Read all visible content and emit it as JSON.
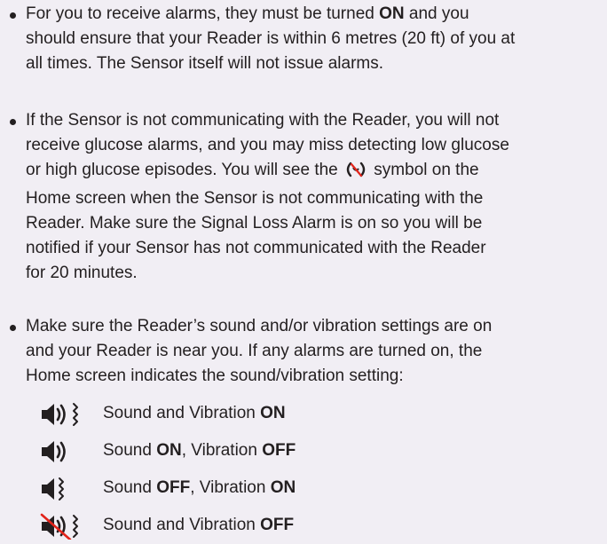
{
  "bullets": [
    {
      "lines": [
        [
          "For you to receive alarms, they must be turned ",
          {
            "b": "ON"
          },
          " and you"
        ],
        [
          "should ensure that your Reader is within 6 metres (20 ft) of you at"
        ],
        [
          "all times. The Sensor itself will not issue alarms."
        ]
      ]
    },
    {
      "lines": [
        [
          "If the Sensor is not communicating with the Reader, you will not"
        ],
        [
          "receive glucose alarms, and you may miss detecting low glucose"
        ],
        [
          "or high glucose episodes. You will see the ",
          {
            "icon": "signal-loss-icon"
          },
          " symbol on the"
        ],
        [
          "Home screen when the Sensor is not communicating with the"
        ],
        [
          "Reader. Make sure the Signal Loss Alarm is on so you will be"
        ],
        [
          "notified if your Sensor has not communicated with the Reader"
        ],
        [
          "for 20 minutes."
        ]
      ]
    },
    {
      "lines": [
        [
          "Make sure the Reader’s sound and/or vibration settings are on"
        ],
        [
          "and your Reader is near you. If any alarms are turned on, the"
        ],
        [
          "Home screen indicates the sound/vibration setting:"
        ]
      ]
    }
  ],
  "settings": [
    {
      "icon": "sound-on-vibration-on-icon",
      "parts": [
        "Sound and Vibration ",
        {
          "b": "ON"
        }
      ]
    },
    {
      "icon": "sound-on-vibration-off-icon",
      "parts": [
        "Sound ",
        {
          "b": "ON"
        },
        ", Vibration ",
        {
          "b": "OFF"
        }
      ]
    },
    {
      "icon": "sound-off-vibration-on-icon",
      "parts": [
        "Sound ",
        {
          "b": "OFF"
        },
        ", Vibration ",
        {
          "b": "ON"
        }
      ]
    },
    {
      "icon": "sound-off-vibration-off-icon",
      "parts": [
        "Sound and Vibration ",
        {
          "b": "OFF"
        }
      ]
    }
  ],
  "colors": {
    "text": "#231f20",
    "strike": "#e2231a",
    "background": "#f1eef4"
  }
}
